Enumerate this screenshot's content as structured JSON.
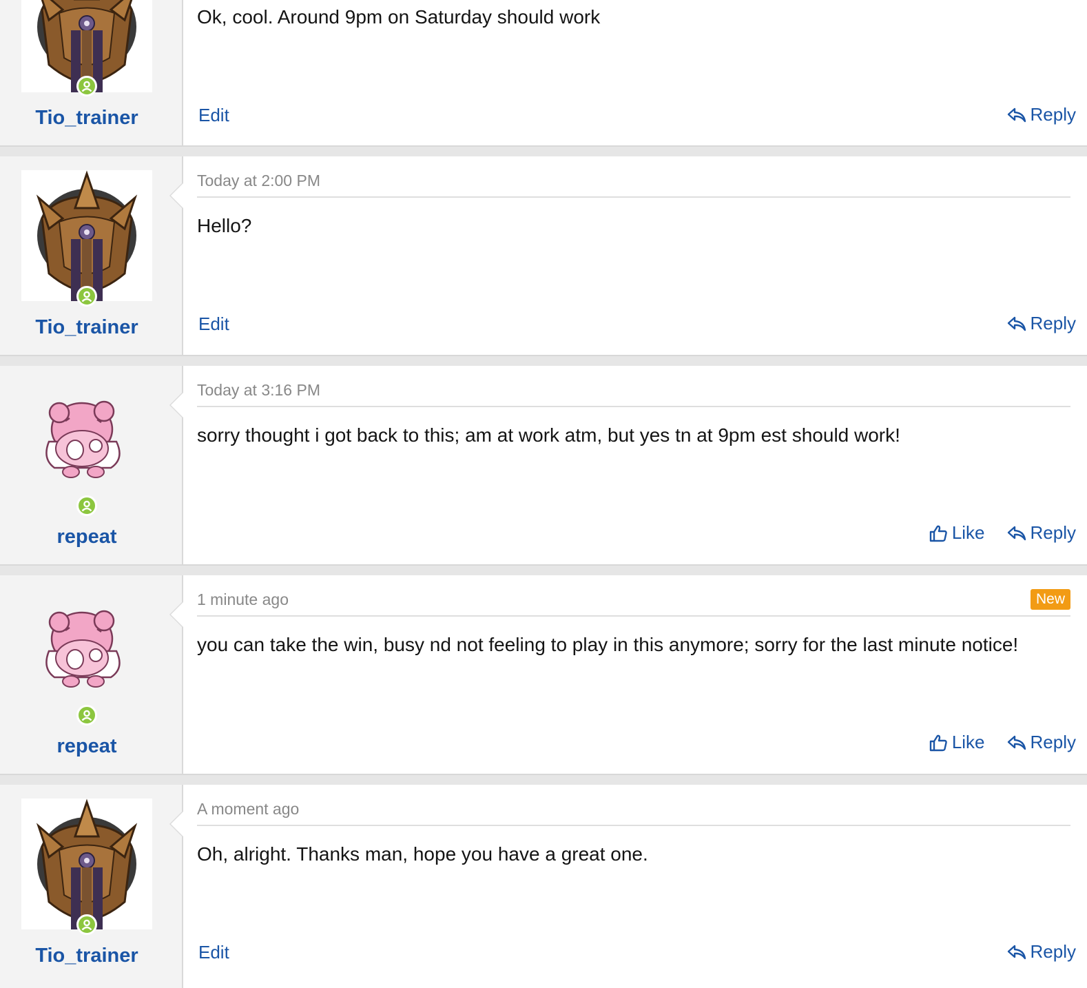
{
  "colors": {
    "link": "#1a55a6",
    "online": "#8cc63f",
    "badge": "#f29b14",
    "meta_text": "#888888",
    "body_text": "#141414"
  },
  "posts": [
    {
      "author": "Tio_trainer",
      "avatar": "hooded-pokemon-avatar",
      "timestamp": "",
      "message": "Ok, cool. Around 9pm on Saturday should work",
      "edit_label": "Edit",
      "like_label": "",
      "reply_label": "Reply",
      "badge": ""
    },
    {
      "author": "Tio_trainer",
      "avatar": "hooded-pokemon-avatar",
      "timestamp": "Today at 2:00 PM",
      "message": "Hello?",
      "edit_label": "Edit",
      "like_label": "",
      "reply_label": "Reply",
      "badge": ""
    },
    {
      "author": "repeat",
      "avatar": "pink-pokemon-avatar",
      "timestamp": "Today at 3:16 PM",
      "message": "sorry thought i got back to this; am at work atm, but yes tn at 9pm est should work!",
      "edit_label": "",
      "like_label": "Like",
      "reply_label": "Reply",
      "badge": ""
    },
    {
      "author": "repeat",
      "avatar": "pink-pokemon-avatar",
      "timestamp": "1 minute ago",
      "message": "you can take the win, busy nd not feeling to play in this anymore; sorry for the last minute notice!",
      "edit_label": "",
      "like_label": "Like",
      "reply_label": "Reply",
      "badge": "New"
    },
    {
      "author": "Tio_trainer",
      "avatar": "hooded-pokemon-avatar",
      "timestamp": "A moment ago",
      "message": "Oh, alright. Thanks man, hope you have a great one.",
      "edit_label": "Edit",
      "like_label": "",
      "reply_label": "Reply",
      "badge": ""
    }
  ]
}
